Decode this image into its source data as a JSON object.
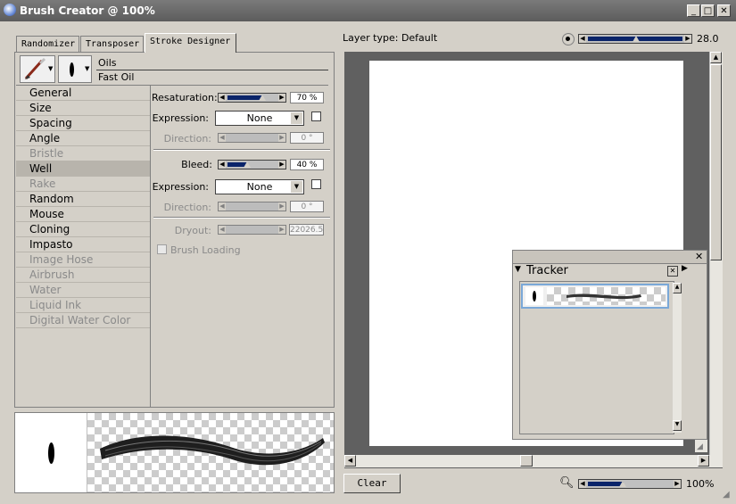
{
  "window": {
    "title": "Brush Creator @ 100%"
  },
  "tabs": [
    {
      "label": "Randomizer"
    },
    {
      "label": "Transposer"
    },
    {
      "label": "Stroke Designer"
    }
  ],
  "brush": {
    "category": "Oils",
    "variant": "Fast Oil"
  },
  "categories": [
    {
      "label": "General",
      "enabled": true
    },
    {
      "label": "Size",
      "enabled": true
    },
    {
      "label": "Spacing",
      "enabled": true
    },
    {
      "label": "Angle",
      "enabled": true
    },
    {
      "label": "Bristle",
      "enabled": false
    },
    {
      "label": "Well",
      "enabled": true,
      "selected": true
    },
    {
      "label": "Rake",
      "enabled": false
    },
    {
      "label": "Random",
      "enabled": true
    },
    {
      "label": "Mouse",
      "enabled": true
    },
    {
      "label": "Cloning",
      "enabled": true
    },
    {
      "label": "Impasto",
      "enabled": true
    },
    {
      "label": "Image Hose",
      "enabled": false
    },
    {
      "label": "Airbrush",
      "enabled": false
    },
    {
      "label": "Water",
      "enabled": false
    },
    {
      "label": "Liquid Ink",
      "enabled": false
    },
    {
      "label": "Digital Water Color",
      "enabled": false
    }
  ],
  "well": {
    "resaturation": {
      "label": "Resaturation:",
      "value": "70 %",
      "level": 0.7
    },
    "expression1": {
      "label": "Expression:",
      "value": "None"
    },
    "direction1": {
      "label": "Direction:",
      "value": "0 °"
    },
    "bleed": {
      "label": "Bleed:",
      "value": "40 %",
      "level": 0.4
    },
    "expression2": {
      "label": "Expression:",
      "value": "None"
    },
    "direction2": {
      "label": "Direction:",
      "value": "0 °"
    },
    "dryout": {
      "label": "Dryout:",
      "value": "22026.5"
    },
    "brush_loading": {
      "label": "Brush Loading"
    }
  },
  "canvas": {
    "layer_type": "Layer type: Default",
    "size_value": "28.0",
    "zoom_value": "100%"
  },
  "tracker": {
    "title": "Tracker"
  },
  "buttons": {
    "clear": "Clear"
  },
  "colors": {
    "slider_fill": "#0a246a",
    "panel": "#d4d0c8",
    "canvas_bg": "#606060"
  }
}
